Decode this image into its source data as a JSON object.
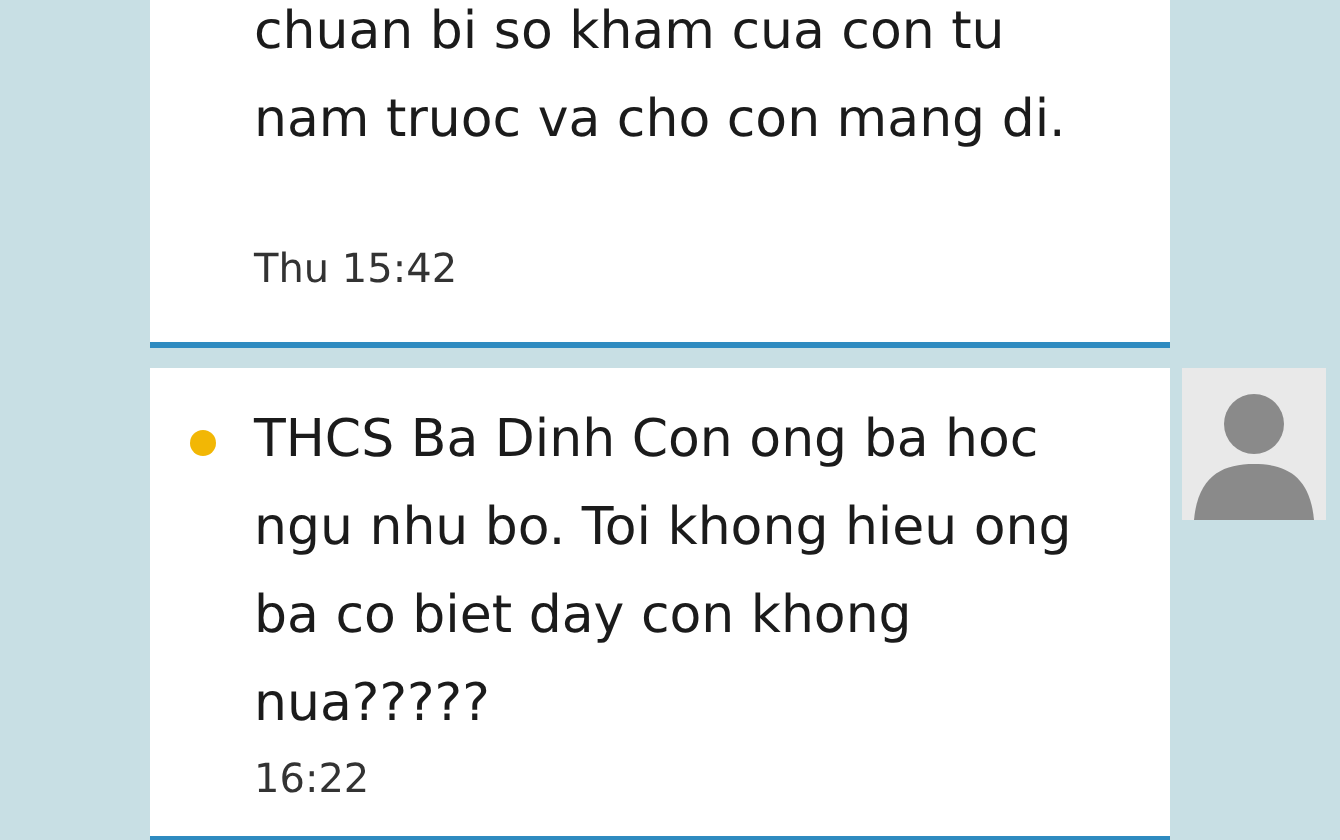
{
  "messages": [
    {
      "text": "chuan bi so kham cua con tu nam truoc va cho con mang di.",
      "time": "Thu 15:42",
      "unread": false
    },
    {
      "text": "THCS Ba Dinh Con ong ba hoc ngu nhu bo. Toi khong hieu ong ba co biet day con khong nua?????",
      "time": "16:22",
      "unread": true,
      "avatar": true
    }
  ]
}
